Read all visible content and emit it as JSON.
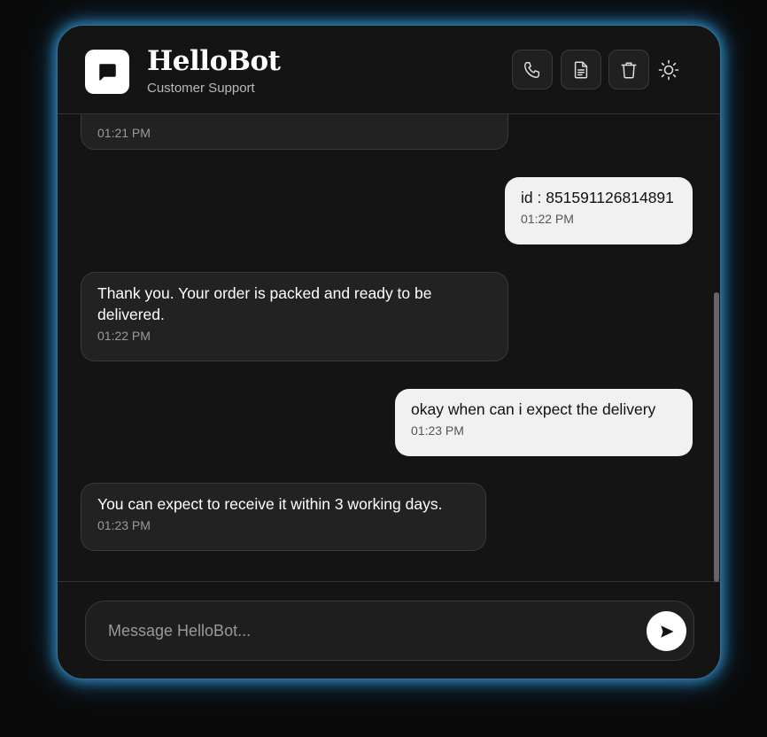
{
  "header": {
    "title": "HelloBot",
    "subtitle": "Customer Support",
    "buttons": [
      {
        "name": "call",
        "icon": "phone-icon"
      },
      {
        "name": "transcript",
        "icon": "document-icon"
      },
      {
        "name": "clear-chat",
        "icon": "trash-icon"
      },
      {
        "name": "theme-toggle",
        "icon": "sun-icon"
      }
    ]
  },
  "messages": [
    {
      "sender": "bot",
      "text": "",
      "time": "01:21 PM"
    },
    {
      "sender": "user",
      "text": "id : 851591126814891",
      "time": "01:22 PM"
    },
    {
      "sender": "bot",
      "text": "Thank you. Your order is packed and ready to be delivered.",
      "time": "01:22 PM"
    },
    {
      "sender": "user",
      "text": "okay when can i expect the delivery",
      "time": "01:23 PM"
    },
    {
      "sender": "bot",
      "text": "You can expect to receive it within 3 working days.",
      "time": "01:23 PM"
    }
  ],
  "composer": {
    "placeholder": "Message HelloBot...",
    "value": ""
  },
  "colors": {
    "accent_glow": "#38aaeb",
    "bot_bubble": "#222222",
    "user_bubble": "#f1f1f1",
    "background": "#141414"
  }
}
